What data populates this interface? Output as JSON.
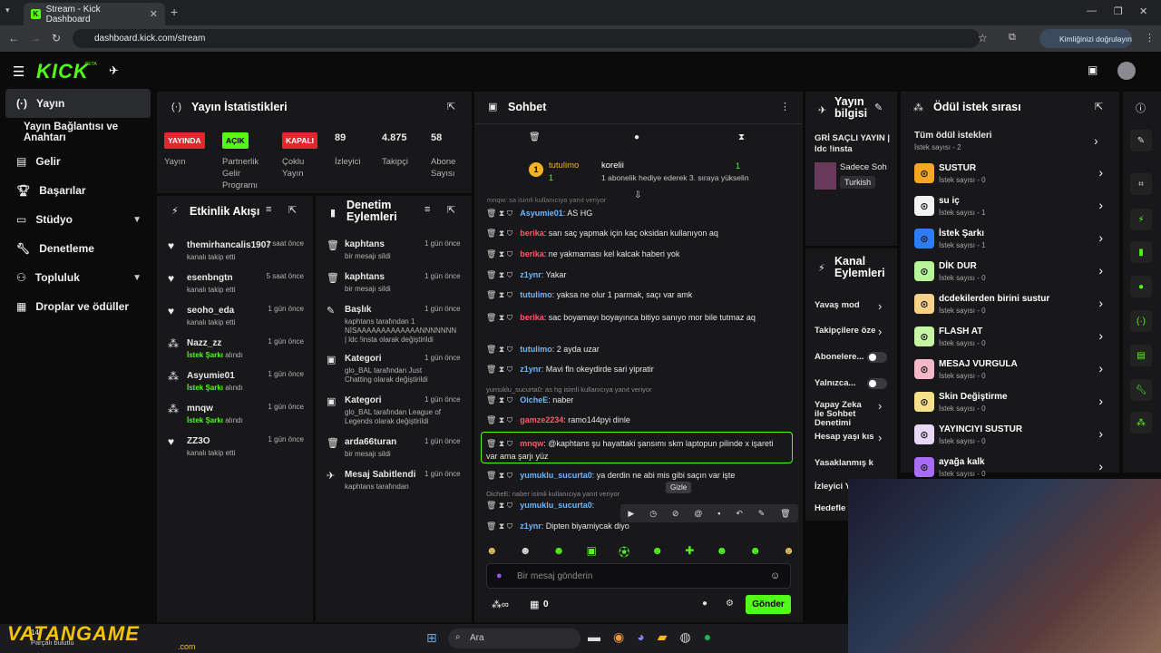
{
  "browser": {
    "tab_title": "Stream - Kick Dashboard",
    "url": "dashboard.kick.com/stream",
    "verify_label": "Kimliğinizi doğrulayın"
  },
  "app": {
    "logo": "KICK",
    "beta": "BETA"
  },
  "sidebar": {
    "items": [
      {
        "label": "Yayın",
        "icon": "broadcast-icon"
      },
      {
        "label": "Yayın Bağlantısı ve Anahtarı",
        "icon": ""
      },
      {
        "label": "Gelir",
        "icon": "chart-icon"
      },
      {
        "label": "Başarılar",
        "icon": "trophy-icon"
      },
      {
        "label": "Stüdyo",
        "icon": "studio-icon"
      },
      {
        "label": "Denetleme",
        "icon": "wrench-icon"
      },
      {
        "label": "Topluluk",
        "icon": "community-icon"
      },
      {
        "label": "Droplar ve ödüller",
        "icon": "gift-icon"
      }
    ]
  },
  "stats": {
    "title": "Yayın İstatistikleri",
    "cells": [
      {
        "badge": "YAYINDA",
        "badge_color": "#e3262c",
        "label": "Yayın"
      },
      {
        "badge": "AÇIK",
        "badge_color": "#53fc18",
        "label": "Partnerlik Gelir Programı"
      },
      {
        "badge": "KAPALI",
        "badge_color": "#e3262c",
        "label": "Çoklu Yayın"
      },
      {
        "badge": "89",
        "badge_color": "",
        "label": "İzleyici"
      },
      {
        "badge": "4.875",
        "badge_color": "",
        "label": "Takipçi"
      },
      {
        "badge": "58",
        "badge_color": "",
        "label": "Abone Sayısı"
      }
    ]
  },
  "activity": {
    "title": "Etkinlik Akışı",
    "items": [
      {
        "name": "themirhancalis1907",
        "action": "kanalı takip etti",
        "time": "1 saat önce",
        "icon": "heart-icon",
        "highlight": ""
      },
      {
        "name": "esenbngtn",
        "action": "kanalı takip etti",
        "time": "5 saat önce",
        "icon": "heart-icon",
        "highlight": ""
      },
      {
        "name": "seoho_eda",
        "action": "kanalı takip etti",
        "time": "1 gün önce",
        "icon": "heart-icon",
        "highlight": ""
      },
      {
        "name": "Nazz_zz",
        "action": "alındı",
        "time": "1 gün önce",
        "icon": "reward-icon",
        "highlight": "İstek Şarkı"
      },
      {
        "name": "Asyumie01",
        "action": "alındı",
        "time": "1 gün önce",
        "icon": "reward-icon",
        "highlight": "İstek Şarkı"
      },
      {
        "name": "mnqw",
        "action": "alındı",
        "time": "1 gün önce",
        "icon": "reward-icon",
        "highlight": "İstek Şarkı"
      },
      {
        "name": "ZZ3O",
        "action": "kanalı takip etti",
        "time": "1 gün önce",
        "icon": "heart-icon",
        "highlight": ""
      }
    ]
  },
  "moderation": {
    "title": "Denetim Eylemleri",
    "items": [
      {
        "title": "kaphtans",
        "desc": "bir mesajı sildi",
        "time": "1 gün önce",
        "icon": "trash-icon"
      },
      {
        "title": "kaphtans",
        "desc": "bir mesajı sildi",
        "time": "1 gün önce",
        "icon": "trash-icon"
      },
      {
        "title": "Başlık",
        "desc": "kaphtans tarafından 1 NİSAAAAAAAAAAAAANNNNNNN | ldc !insta olarak değiştirildi",
        "time": "1 gün önce",
        "icon": "edit-icon"
      },
      {
        "title": "Kategori",
        "desc": "glo_BAL tarafından Just Chatting olarak değiştirildi",
        "time": "1 gün önce",
        "icon": "category-icon"
      },
      {
        "title": "Kategori",
        "desc": "glo_BAL tarafından League of Legends olarak değiştirildi",
        "time": "1 gün önce",
        "icon": "category-icon"
      },
      {
        "title": "arda66turan",
        "desc": "bir mesajı sildi",
        "time": "1 gün önce",
        "icon": "trash-icon"
      },
      {
        "title": "Mesaj Sabitlendi",
        "desc": "kaphtans tarafından",
        "time": "1 gün önce",
        "icon": "pin-icon"
      }
    ]
  },
  "chat": {
    "title": "Sohbet",
    "gifter": "tutulimo",
    "gifter_count": "1",
    "gifted": "korelii",
    "gift_text": "1 abonelik hediye ederek 3. sıraya yükselin",
    "gift_rank": "1",
    "reply_hint_top": "mnqw: sa isimli kullanıcıya yanıt veriyor",
    "messages": [
      {
        "user": "Asyumie01",
        "text": "AS HG",
        "color": "#6bb8ff"
      },
      {
        "user": "berika",
        "text": "sarı saç yapmak için kaç oksidan kullanıyon aq",
        "color": "#ff5a6a"
      },
      {
        "user": "berika",
        "text": "ne yakmaması kel kalcak haberi yok",
        "color": "#ff5a6a"
      },
      {
        "user": "z1ynr",
        "text": "Yakar",
        "color": "#6bb8ff"
      },
      {
        "user": "tutulimo",
        "text": "yaksa ne olur 1 parmak, saçı var amk",
        "color": "#6bb8ff"
      },
      {
        "user": "berika",
        "text": "sac boyamayı boyayınca bitiyo sanıyo mor bile tutmaz aq",
        "color": "#ff5a6a"
      },
      {
        "user": "tutulimo",
        "text": "2 ayda uzar",
        "color": "#6bb8ff"
      },
      {
        "user": "z1ynr",
        "text": "Mavi fln okeydirde sari yipratir",
        "color": "#6bb8ff"
      },
      {
        "user": "OicheE",
        "text": "naber",
        "color": "#6bb8ff"
      },
      {
        "user": "gamze2234",
        "text": "ramo144pyi dinle",
        "color": "#ff5a6a"
      },
      {
        "user": "mnqw",
        "text": "@kaphtans şu hayattaki şansımı skm laptopun pilinde x işareti var ama şarjı yüz",
        "color": "#ff5a6a"
      },
      {
        "user": "yumuklu_sucurta0",
        "text": "ya derdin ne abi mis gibi saçın var işte",
        "color": "#6bb8ff"
      },
      {
        "user": "yumuklu_sucurta0",
        "text": "",
        "color": "#6bb8ff"
      },
      {
        "user": "z1ynr",
        "text": "Dipten biyamiycak diyo",
        "color": "#6bb8ff"
      }
    ],
    "reply_hints": [
      "yumuklu_sucurta0: as hg isimli kullanıcıya yanıt veriyor",
      "OicheE: naber isimli kullanıcıya yanıt veriyor"
    ],
    "tooltip": "Gizle",
    "input_placeholder": "Bir mesaj gönderin",
    "send_label": "Gönder",
    "points": "0"
  },
  "stream_info": {
    "title": "Yayın bilgisi",
    "stream_title": "GRİ SAÇLI YAYIN | ldc !insta",
    "category": "Sadece Soh",
    "tag": "Turkish"
  },
  "channel_actions": {
    "title": "Kanal Eylemleri",
    "items": [
      "Yavaş mod",
      "Takipçilere öze",
      "Abonelere...",
      "Yalnızca...",
      "Yapay Zeka ile Sohbet Denetimi",
      "Hesap yaşı kıs",
      "Yasaklanmış k",
      "İzleyici Y",
      "Hedefle"
    ]
  },
  "rewards": {
    "title": "Ödül istek sırası",
    "all_label": "Tüm ödül istekleri",
    "all_count": "İstek sayısı - 2",
    "items": [
      {
        "name": "SUSTUR",
        "count": "İstek sayısı - 0",
        "color": "#f5a623"
      },
      {
        "name": "su iç",
        "count": "İstek sayısı - 1",
        "color": "#f2f2f2"
      },
      {
        "name": "İstek Şarkı",
        "count": "İstek sayısı - 1",
        "color": "#2f7df6"
      },
      {
        "name": "DİK DUR",
        "count": "İstek sayısı - 0",
        "color": "#b8f59a"
      },
      {
        "name": "dcdekilerden birini sustur",
        "count": "İstek sayısı - 0",
        "color": "#f7d08a"
      },
      {
        "name": "FLASH AT",
        "count": "İstek sayısı - 0",
        "color": "#c7f5a6"
      },
      {
        "name": "MESAJ VURGULA",
        "count": "İstek sayısı - 0",
        "color": "#f5b8c8"
      },
      {
        "name": "Skin Değiştirme",
        "count": "İstek sayısı - 0",
        "color": "#f7e08a"
      },
      {
        "name": "YAYINCIYI SUSTUR",
        "count": "İstek sayısı - 0",
        "color": "#e8d8f5"
      },
      {
        "name": "ayağa kalk",
        "count": "İstek sayısı - 0",
        "color": "#a86cf5"
      }
    ]
  },
  "taskbar": {
    "search": "Ara",
    "watermark": "VATANGAME",
    "watermark_sub": ".com",
    "tray_num": "14",
    "tray_text": "Parçalı bulutlu"
  }
}
